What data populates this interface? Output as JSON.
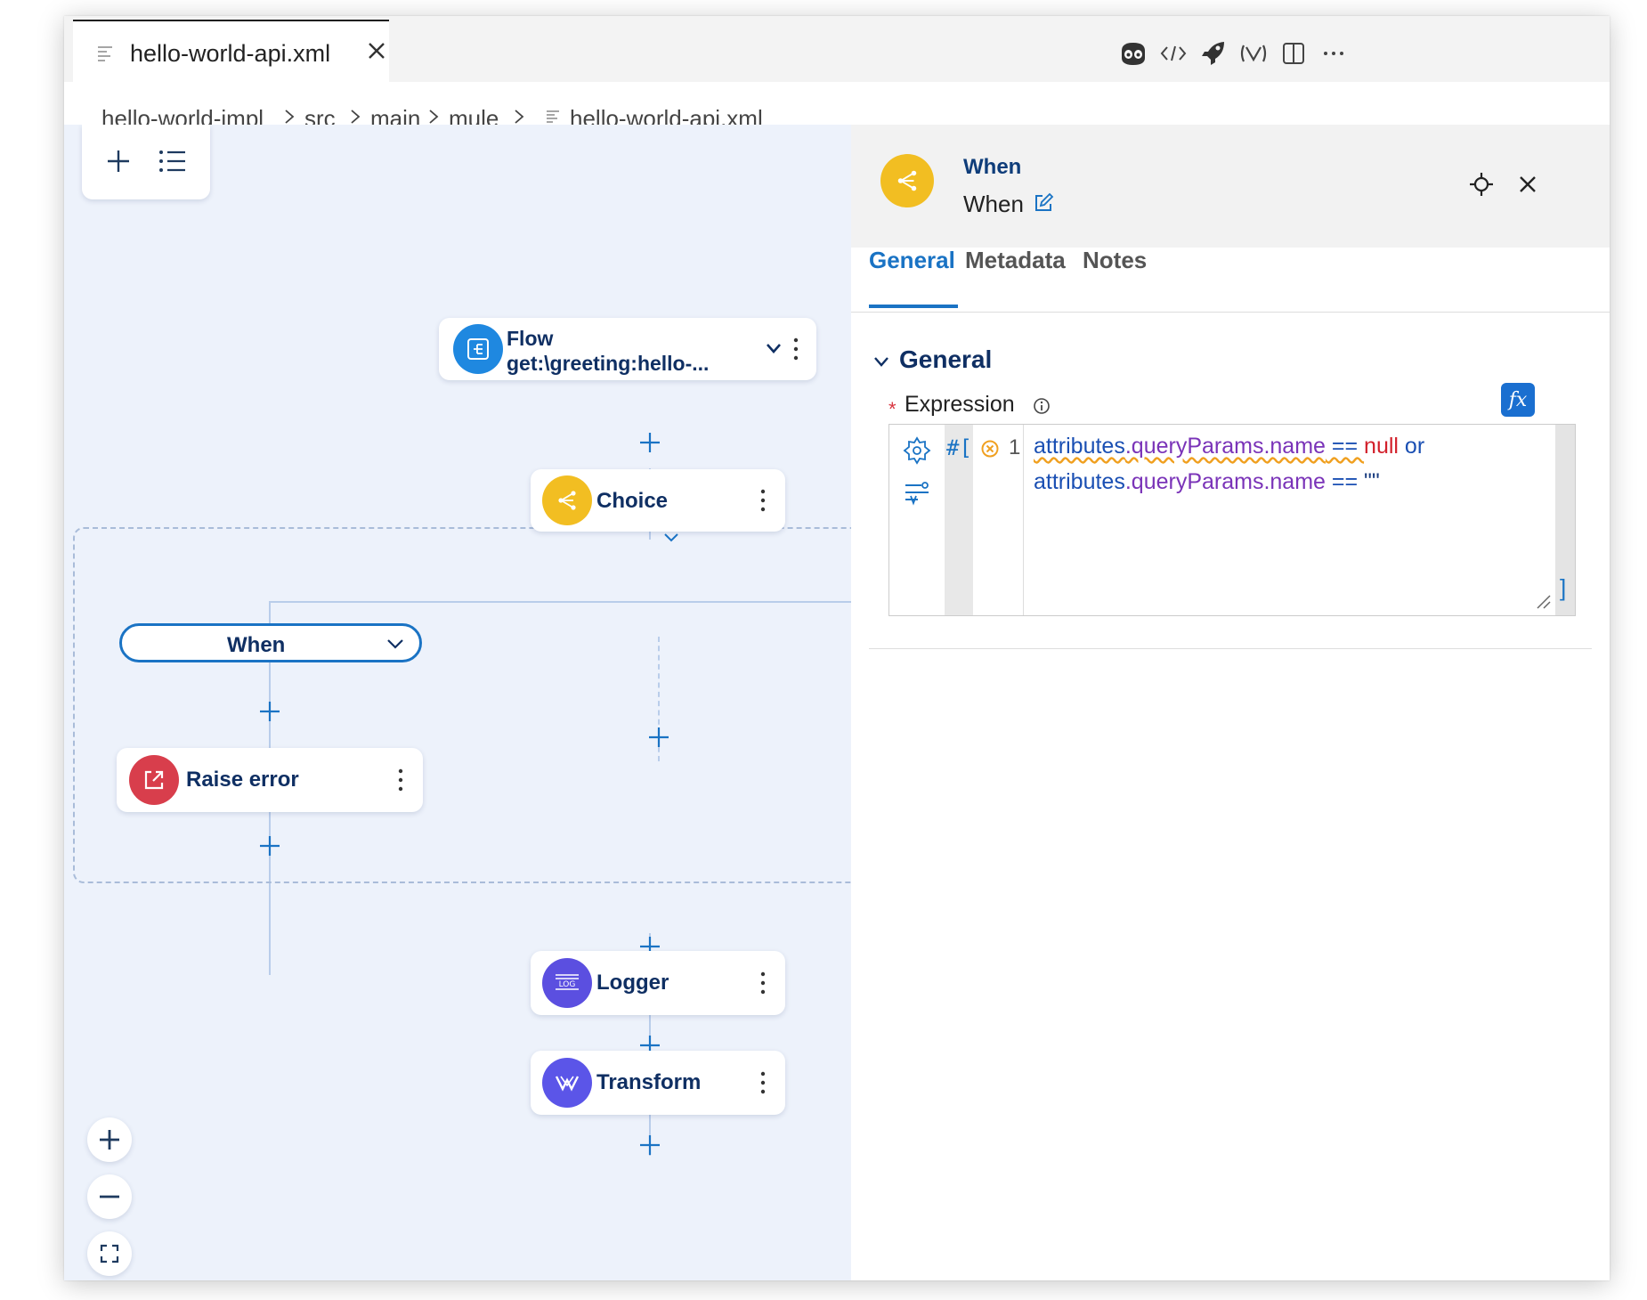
{
  "editor": {
    "tab": {
      "title": "hello-world-api.xml"
    },
    "toolbar_icons": [
      "copilot-icon",
      "code-icon",
      "deploy-rocket-icon",
      "mulesoft-icon",
      "split-editor-icon",
      "more-icon"
    ],
    "breadcrumb": [
      "hello-world-impl",
      "src",
      "main",
      "mule",
      "hello-world-api.xml"
    ]
  },
  "canvas": {
    "flow": {
      "title": "Flow",
      "subtitle": "get:\\greeting:hello-..."
    },
    "choice": {
      "label": "Choice"
    },
    "when_route": {
      "label": "When"
    },
    "raise_error": {
      "label": "Raise error"
    },
    "logger": {
      "label": "Logger"
    },
    "logger_icon_text": "LOG",
    "transform": {
      "label": "Transform"
    },
    "zoom_controls": [
      "zoom-in",
      "zoom-out",
      "fit-view"
    ]
  },
  "panel": {
    "title": "When",
    "subtitle": "When",
    "tabs": [
      "General",
      "Metadata",
      "Notes"
    ],
    "active_tab": "General",
    "section_title": "General",
    "expression": {
      "label": "Expression",
      "required_marker": "*",
      "fx_label": "fx",
      "prefix": "#[",
      "line_number": "1",
      "line1": [
        "attributes",
        ".queryParams.name",
        " == ",
        "null",
        " or"
      ],
      "line2": [
        "attributes",
        ".queryParams.name",
        " == ",
        "\"\""
      ],
      "closing": "]"
    }
  },
  "colors": {
    "accent": "#1a73c4",
    "node_text": "#0f2f63",
    "choice_yellow": "#f2be22",
    "flow_blue": "#1f88e0",
    "raise_red": "#d83e4c",
    "logger_purple": "#5b4fe0",
    "transform_purple": "#5b55e8",
    "canvas_bg": "#edf2fb"
  }
}
